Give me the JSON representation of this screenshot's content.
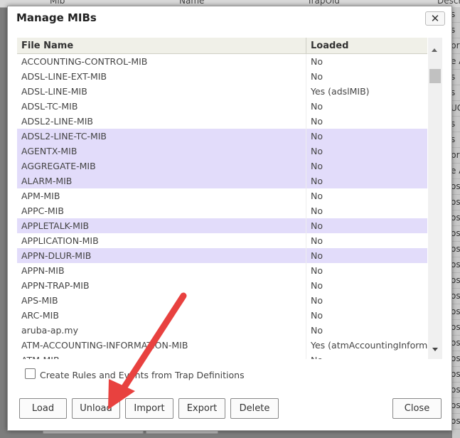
{
  "background": {
    "headers": [
      "Mib",
      "Name",
      "TrapOid",
      "Descr"
    ],
    "right_col": [
      "s",
      "s",
      "pre",
      "e A",
      "s",
      "s",
      "UC",
      "s",
      "s",
      "pre",
      "e A",
      "os",
      "os",
      "os",
      "os",
      "os",
      "os",
      "os",
      "os",
      "os",
      "os",
      "os",
      "os",
      "os",
      "os",
      "os",
      "os"
    ]
  },
  "dialog": {
    "title": "Manage MIBs",
    "close_symbol": "✕",
    "columns": {
      "file_name": "File Name",
      "loaded": "Loaded"
    },
    "rows": [
      {
        "file": "ACCOUNTING-CONTROL-MIB",
        "loaded": "No",
        "selected": false
      },
      {
        "file": "ADSL-LINE-EXT-MIB",
        "loaded": "No",
        "selected": false
      },
      {
        "file": "ADSL-LINE-MIB",
        "loaded": "Yes (adslMIB)",
        "selected": false
      },
      {
        "file": "ADSL-TC-MIB",
        "loaded": "No",
        "selected": false
      },
      {
        "file": "ADSL2-LINE-MIB",
        "loaded": "No",
        "selected": false
      },
      {
        "file": "ADSL2-LINE-TC-MIB",
        "loaded": "No",
        "selected": true
      },
      {
        "file": "AGENTX-MIB",
        "loaded": "No",
        "selected": true
      },
      {
        "file": "AGGREGATE-MIB",
        "loaded": "No",
        "selected": true
      },
      {
        "file": "ALARM-MIB",
        "loaded": "No",
        "selected": true
      },
      {
        "file": "APM-MIB",
        "loaded": "No",
        "selected": false
      },
      {
        "file": "APPC-MIB",
        "loaded": "No",
        "selected": false
      },
      {
        "file": "APPLETALK-MIB",
        "loaded": "No",
        "selected": true
      },
      {
        "file": "APPLICATION-MIB",
        "loaded": "No",
        "selected": false
      },
      {
        "file": "APPN-DLUR-MIB",
        "loaded": "No",
        "selected": true
      },
      {
        "file": "APPN-MIB",
        "loaded": "No",
        "selected": false
      },
      {
        "file": "APPN-TRAP-MIB",
        "loaded": "No",
        "selected": false
      },
      {
        "file": "APS-MIB",
        "loaded": "No",
        "selected": false
      },
      {
        "file": "ARC-MIB",
        "loaded": "No",
        "selected": false
      },
      {
        "file": "aruba-ap.my",
        "loaded": "No",
        "selected": false
      },
      {
        "file": "ATM-ACCOUNTING-INFORMATION-MIB",
        "loaded": "Yes (atmAccountingInforma",
        "selected": false
      },
      {
        "file": "ATM-MIB",
        "loaded": "No",
        "selected": false
      }
    ],
    "checkbox_label": "Create Rules and Events from Trap Definitions",
    "checkbox_checked": false,
    "buttons": {
      "load": "Load",
      "unload": "Unload",
      "import": "Import",
      "export": "Export",
      "delete": "Delete",
      "close": "Close"
    },
    "annotation_arrow_color": "#e8413f"
  }
}
